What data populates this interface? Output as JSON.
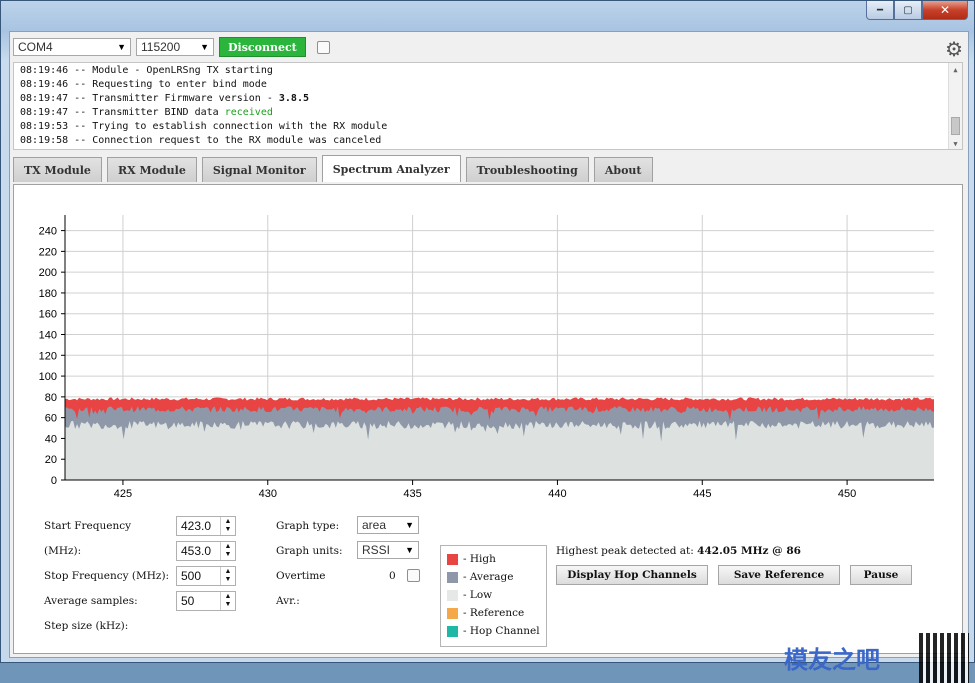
{
  "window": {
    "controls": [
      "minimize-icon",
      "maximize-icon",
      "close-icon"
    ]
  },
  "toolbar": {
    "port": "COM4",
    "baud": "115200",
    "connect_label": "Disconnect",
    "icons": [
      "gear-icon"
    ]
  },
  "log": {
    "lines": [
      {
        "text": "08:19:46 -- Module - OpenLRSng TX starting"
      },
      {
        "text": "08:19:46 -- Requesting to enter bind mode"
      },
      {
        "pre": "08:19:47 -- Transmitter Firmware version - ",
        "bold": "3.8.5"
      },
      {
        "pre": "08:19:47 -- Transmitter BIND data ",
        "green": "received"
      },
      {
        "text": "08:19:53 -- Trying to establish connection with the RX module"
      },
      {
        "text": "08:19:58 -- Connection request to the RX module was canceled"
      }
    ]
  },
  "tabs": [
    {
      "label": "TX Module"
    },
    {
      "label": "RX Module"
    },
    {
      "label": "Signal Monitor"
    },
    {
      "label": "Spectrum Analyzer",
      "active": true
    },
    {
      "label": "Troubleshooting"
    },
    {
      "label": "About"
    }
  ],
  "chart_data": {
    "type": "area",
    "x_ticks": [
      425,
      430,
      435,
      440,
      445,
      450
    ],
    "xlim": [
      423.0,
      453.0
    ],
    "y_ticks": [
      0,
      20,
      40,
      60,
      80,
      100,
      120,
      140,
      160,
      180,
      200,
      220,
      240
    ],
    "ylim": [
      0,
      255
    ],
    "grid": true,
    "series": [
      {
        "name": "High",
        "color": "#e84444",
        "level": 78
      },
      {
        "name": "Average",
        "color": "#8e98a8",
        "level": 68
      },
      {
        "name": "Low",
        "color": "#dde2e0",
        "level": 53
      }
    ]
  },
  "controls": {
    "start_freq_label": "Start Frequency",
    "start_freq_unit": "(MHz):",
    "start_freq_value": "423.0",
    "end_freq_value": "453.0",
    "stop_freq_label": "Stop Frequency (MHz):",
    "stop_freq_value": "500",
    "avg_samples_label": "Average samples:",
    "avg_samples_value": "50",
    "step_size_label": "Step size (kHz):",
    "graph_type_label": "Graph type:",
    "graph_type_value": "area",
    "graph_units_label": "Graph units:",
    "graph_units_value": "RSSI",
    "overtime_label": "Overtime",
    "overtime_value": "0",
    "avr_label": "Avr.:"
  },
  "legend": [
    {
      "label": "- High",
      "color": "#e84444"
    },
    {
      "label": "- Average",
      "color": "#8e98a8"
    },
    {
      "label": "- Low",
      "color": "#e5e8e6"
    },
    {
      "label": "- Reference",
      "color": "#f4a84a"
    },
    {
      "label": "- Hop Channel",
      "color": "#1fb7a6"
    }
  ],
  "peak": {
    "prefix": "Highest peak detected at:",
    "value": "442.05 MHz @ 86"
  },
  "buttons": {
    "hop": "Display Hop Channels",
    "save": "Save Reference",
    "pause": "Pause"
  },
  "watermark": {
    "text": "模友之吧",
    "url": "http://www.moz8.com"
  }
}
